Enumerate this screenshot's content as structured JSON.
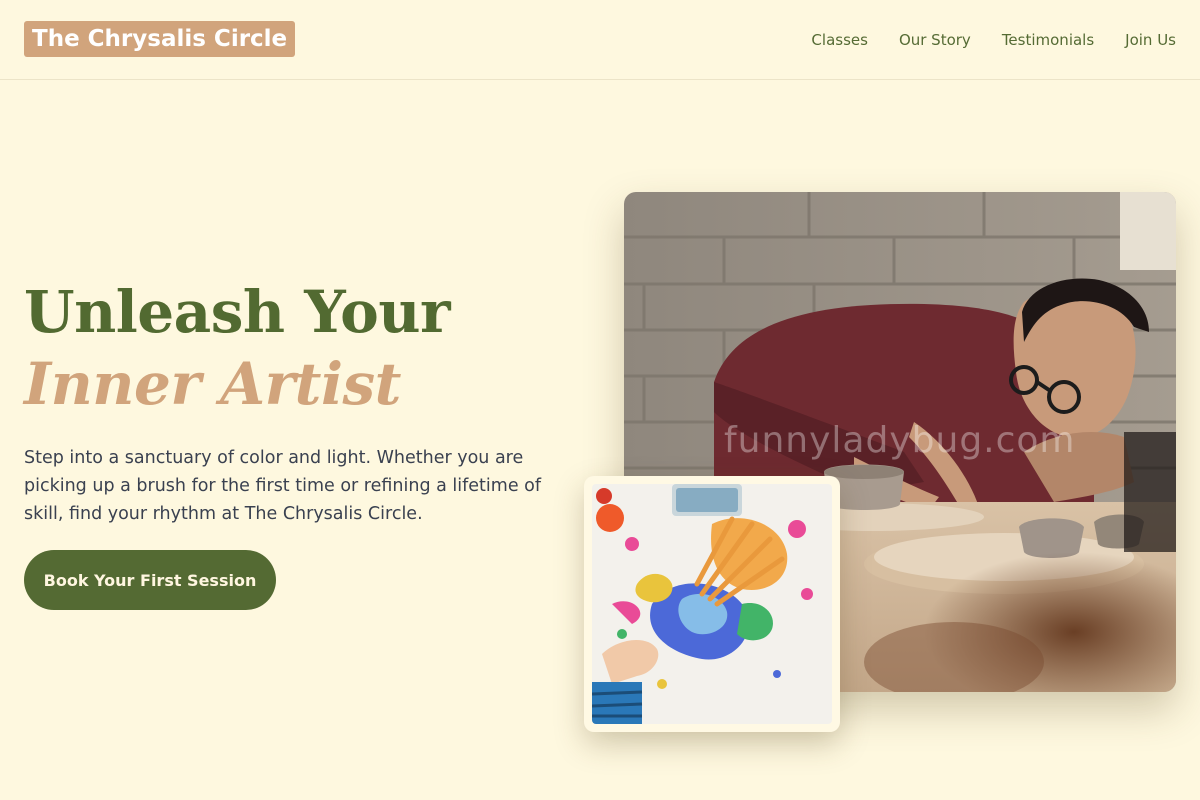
{
  "header": {
    "brand": "The Chrysalis Circle",
    "nav": [
      "Classes",
      "Our Story",
      "Testimonials",
      "Join Us"
    ]
  },
  "hero": {
    "title_line1": "Unleash Your",
    "title_line2": "Inner Artist",
    "description": "Step into a sanctuary of color and light. Whether you are picking up a brush for the first time or refining a lifetime of skill, find your rhythm at The Chrysalis Circle.",
    "cta_label": "Book Your First Session"
  },
  "images": {
    "main_watermark": "funnyladybug.com"
  },
  "colors": {
    "background": "#fef8df",
    "brand_green": "#546a33",
    "accent_tan": "#d1a47c",
    "body_text": "#3a4150"
  }
}
